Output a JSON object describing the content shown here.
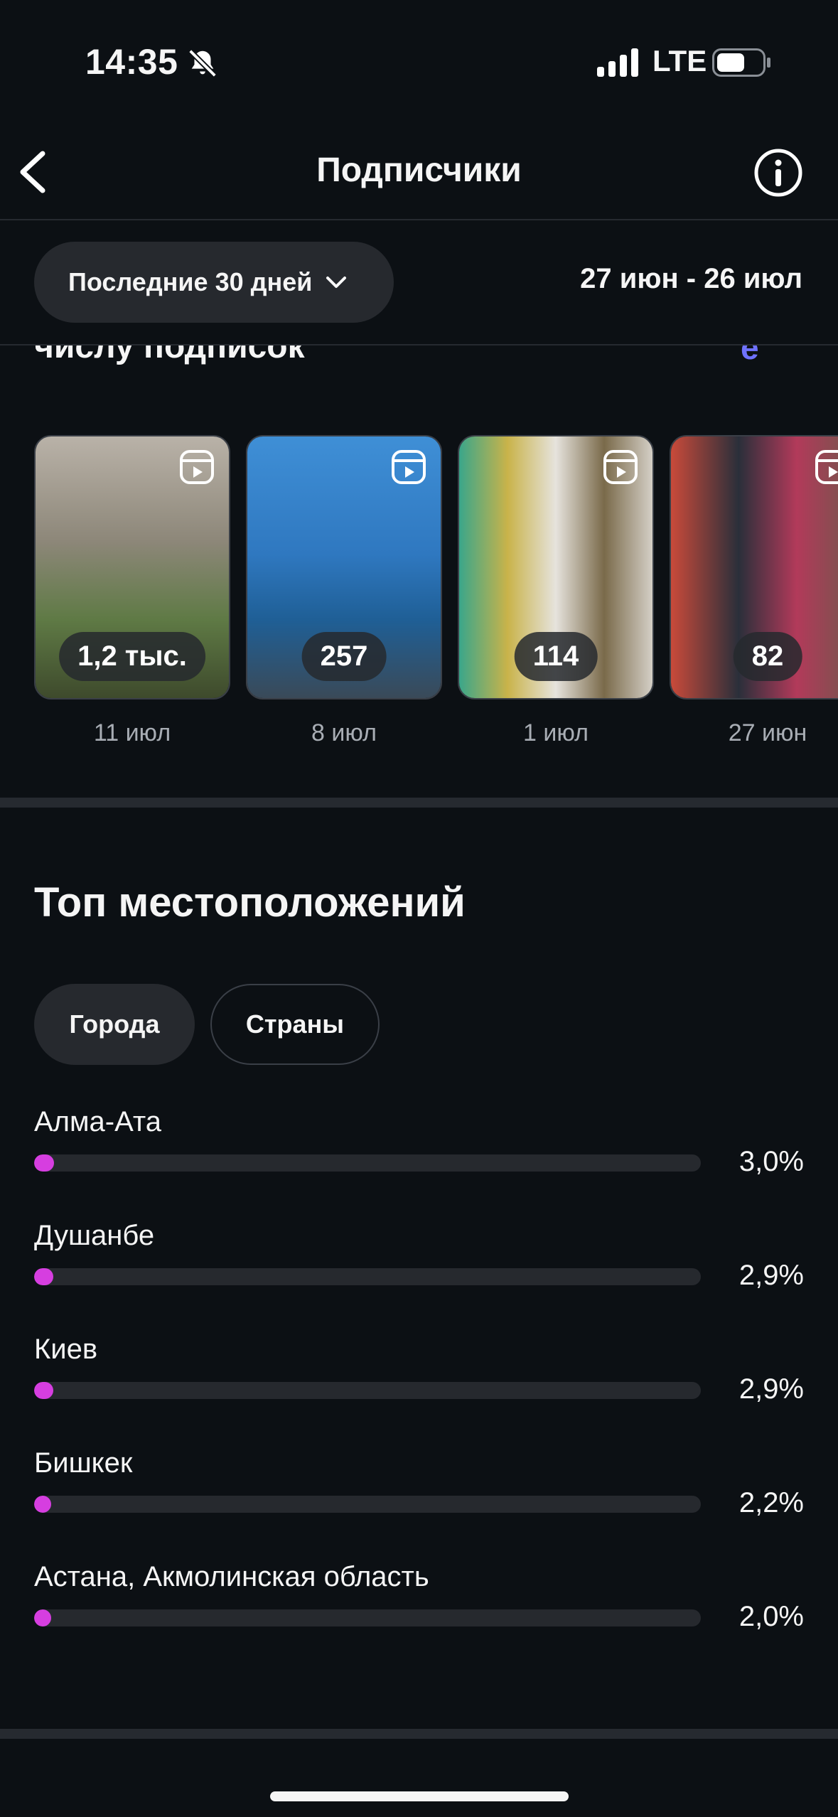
{
  "status": {
    "time": "14:35",
    "network": "LTE"
  },
  "header": {
    "title": "Подписчики"
  },
  "filter": {
    "range_label": "Последние 30 дней",
    "dates": "27 июн - 26 июл"
  },
  "partial_section": {
    "heading": "числу подписок",
    "link": "е"
  },
  "reels": [
    {
      "count": "1,2 тыс.",
      "date": "11 июл"
    },
    {
      "count": "257",
      "date": "8 июл"
    },
    {
      "count": "114",
      "date": "1 июл"
    },
    {
      "count": "82",
      "date": "27 июн"
    }
  ],
  "locations": {
    "title": "Топ местоположений",
    "tabs": [
      "Города",
      "Страны"
    ],
    "active_tab": "Города",
    "items": [
      {
        "name": "Алма-Ата",
        "value": "3,0%",
        "percent": 3.0
      },
      {
        "name": "Душанбе",
        "value": "2,9%",
        "percent": 2.9
      },
      {
        "name": "Киев",
        "value": "2,9%",
        "percent": 2.9
      },
      {
        "name": "Бишкек",
        "value": "2,2%",
        "percent": 2.2
      },
      {
        "name": "Астана, Акмолинская область",
        "value": "2,0%",
        "percent": 2.0
      }
    ]
  },
  "colors": {
    "accent": "#d63ee0",
    "link": "#6f72ff",
    "background": "#0c1014"
  }
}
